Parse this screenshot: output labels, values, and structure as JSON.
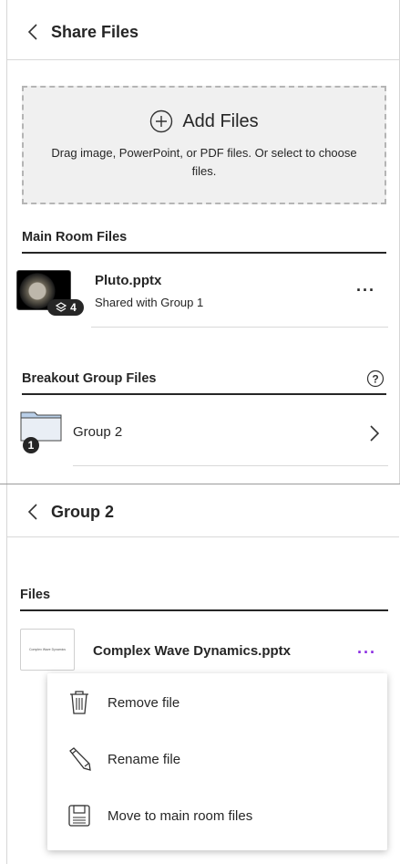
{
  "share_panel": {
    "title": "Share Files",
    "drop_zone": {
      "label": "Add Files",
      "hint": "Drag image, PowerPoint, or PDF files. Or select to choose files."
    },
    "main_room": {
      "header": "Main Room Files",
      "files": [
        {
          "name": "Pluto.pptx",
          "status": "Shared with Group 1",
          "slide_count": "4"
        }
      ]
    },
    "breakout": {
      "header": "Breakout Group Files",
      "groups": [
        {
          "name": "Group 2",
          "file_count": "1"
        }
      ]
    }
  },
  "group_panel": {
    "title": "Group 2",
    "files_header": "Files",
    "file": {
      "name": "Complex Wave Dynamics.pptx",
      "thumb_caption": "Complex Wave Dynamics"
    },
    "menu": [
      {
        "label": "Remove file",
        "icon": "trash-icon"
      },
      {
        "label": "Rename file",
        "icon": "pencil-icon"
      },
      {
        "label": "Move to main room files",
        "icon": "floppy-disk-icon"
      }
    ]
  },
  "colors": {
    "accent": "#8a2be2",
    "text": "#262626",
    "dropzone_bg": "#f0f0f0"
  }
}
